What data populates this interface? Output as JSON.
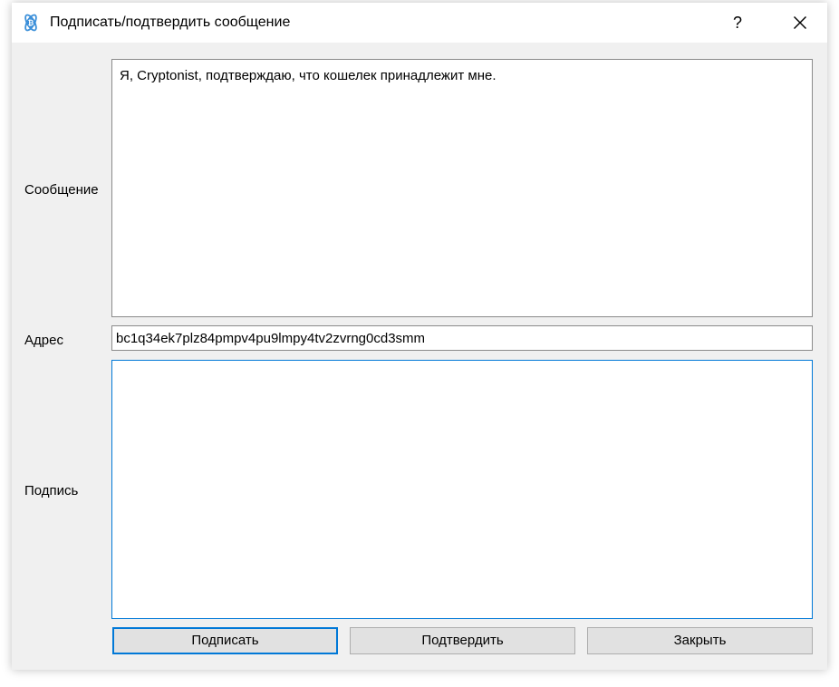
{
  "window": {
    "title": "Подписать/подтвердить сообщение",
    "help_label": "?",
    "icons": {
      "app": "electrum-app-icon",
      "close": "close-icon"
    }
  },
  "form": {
    "message_label": "Сообщение",
    "message_value": "Я, Cryptonist, подтверждаю, что кошелек принадлежит мне.",
    "address_label": "Адрес",
    "address_value": "bc1q34ek7plz84pmpv4pu9lmpy4tv2zvrng0cd3smm",
    "signature_label": "Подпись",
    "signature_value": ""
  },
  "buttons": {
    "sign": "Подписать",
    "verify": "Подтвердить",
    "close": "Закрыть"
  },
  "colors": {
    "accent": "#0078d7",
    "icon_blue": "#3b8fd9",
    "window_bg": "#f0f0f0"
  }
}
